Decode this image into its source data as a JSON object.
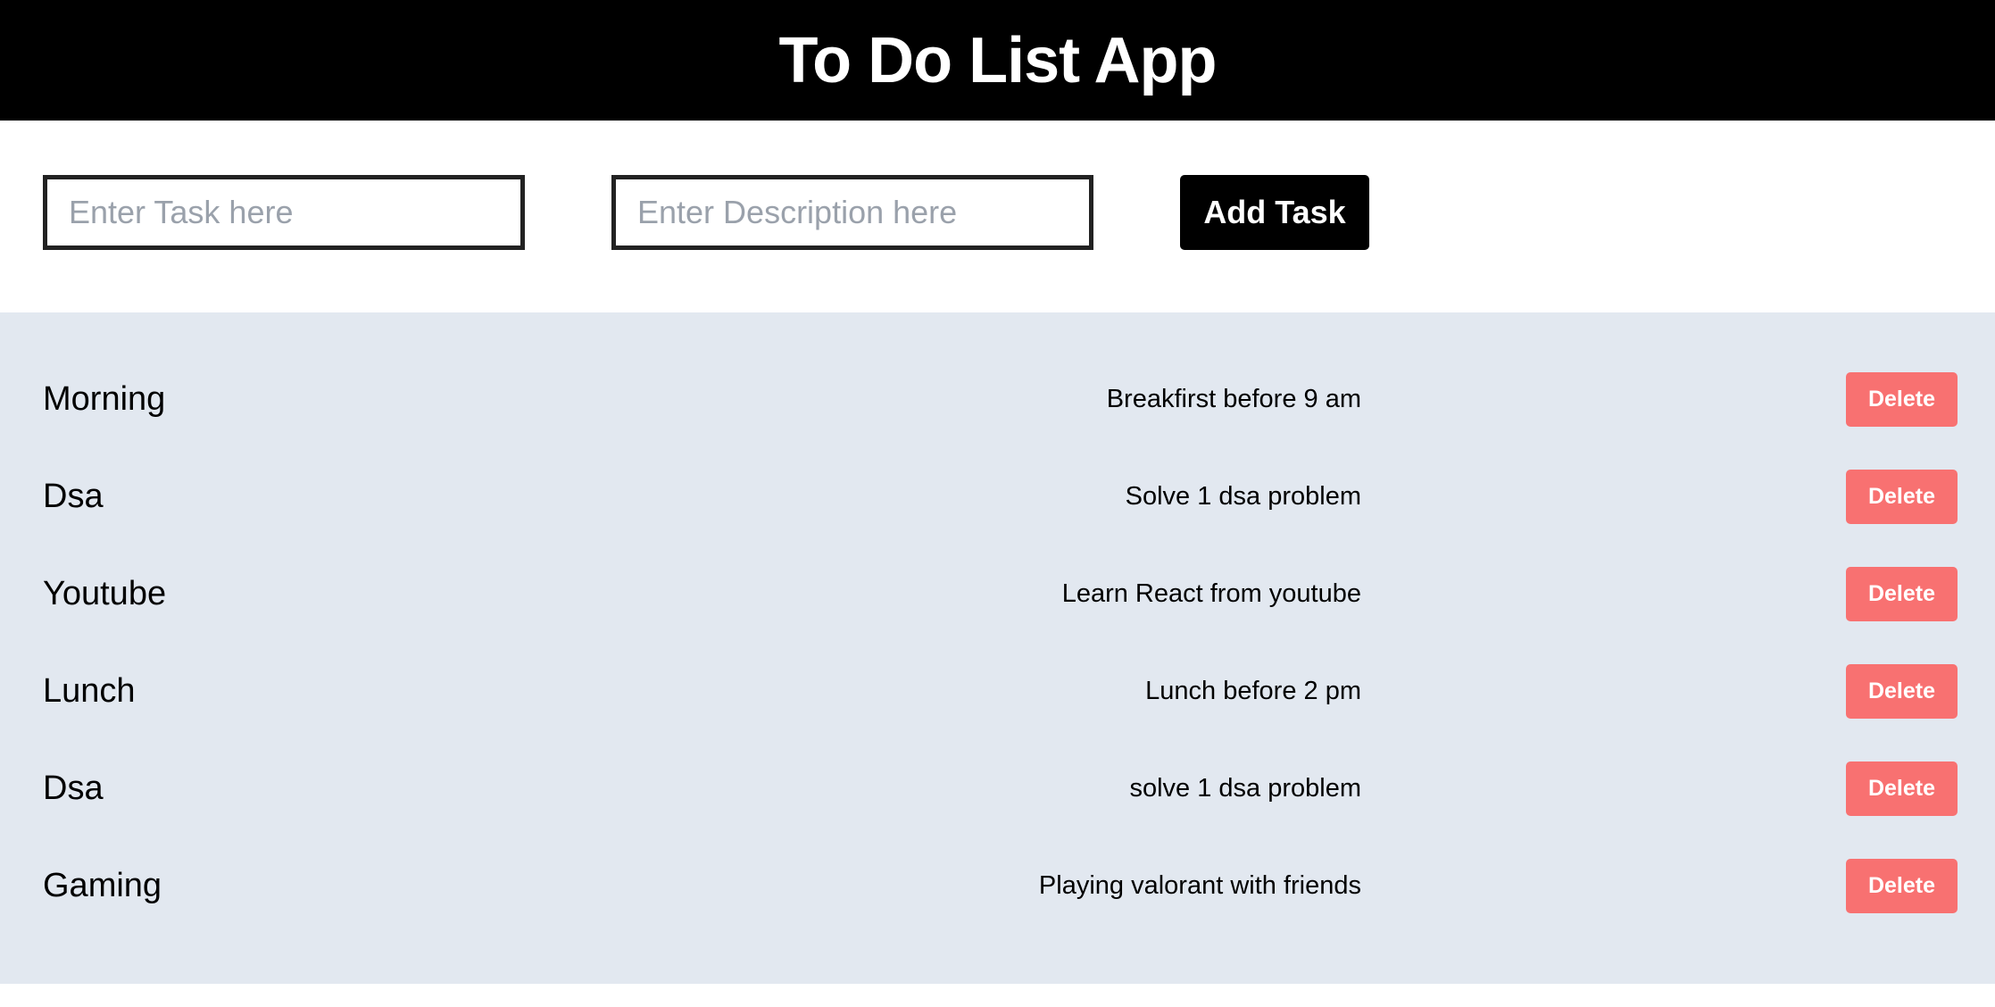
{
  "header": {
    "title": "To Do List App"
  },
  "form": {
    "task_placeholder": "Enter Task here",
    "task_value": "",
    "description_placeholder": "Enter Description here",
    "description_value": "",
    "add_label": "Add Task"
  },
  "tasks": [
    {
      "title": "Morning",
      "description": "Breakfirst before 9 am",
      "delete_label": "Delete"
    },
    {
      "title": "Dsa",
      "description": "Solve 1 dsa problem",
      "delete_label": "Delete"
    },
    {
      "title": "Youtube",
      "description": "Learn React from youtube",
      "delete_label": "Delete"
    },
    {
      "title": "Lunch",
      "description": "Lunch before 2 pm",
      "delete_label": "Delete"
    },
    {
      "title": "Dsa",
      "description": "solve 1 dsa problem",
      "delete_label": "Delete"
    },
    {
      "title": "Gaming",
      "description": "Playing valorant with friends",
      "delete_label": "Delete"
    }
  ],
  "colors": {
    "header_bg": "#000000",
    "list_bg": "#e2e8f0",
    "delete_bg": "#f87171",
    "add_bg": "#000000"
  }
}
